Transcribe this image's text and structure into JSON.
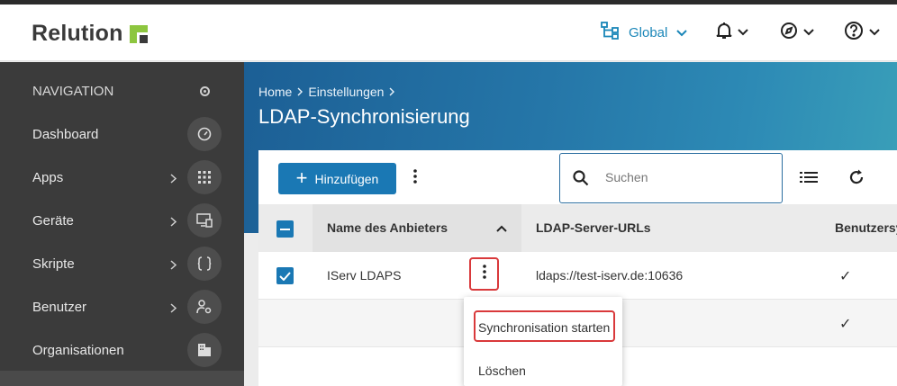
{
  "header": {
    "logo_text": "Relution",
    "global_label": "Global",
    "colors": {
      "accent": "#1a86b8",
      "logo_green": "#8dc63f",
      "logo_text": "#3a3a3a"
    },
    "icons": [
      "org-tree-icon",
      "chevron-down-icon",
      "bell-icon",
      "compass-icon",
      "help-icon"
    ]
  },
  "sidebar": {
    "heading": "NAVIGATION",
    "items": [
      {
        "label": "Dashboard",
        "icon": "speedometer-icon",
        "has_arrow": false
      },
      {
        "label": "Apps",
        "icon": "grid-icon",
        "has_arrow": true
      },
      {
        "label": "Geräte",
        "icon": "devices-icon",
        "has_arrow": true
      },
      {
        "label": "Skripte",
        "icon": "braces-icon",
        "has_arrow": true
      },
      {
        "label": "Benutzer",
        "icon": "user-settings-icon",
        "has_arrow": true
      },
      {
        "label": "Organisationen",
        "icon": "building-icon",
        "has_arrow": false
      }
    ]
  },
  "page": {
    "breadcrumb": [
      "Home",
      "Einstellungen"
    ],
    "title": "LDAP-Synchronisierung"
  },
  "toolbar": {
    "add_label": "Hinzufügen",
    "search_placeholder": "Suchen"
  },
  "table": {
    "columns": [
      "Name des Anbieters",
      "LDAP-Server-URLs",
      "Benutzersy"
    ],
    "rows": [
      {
        "name": "IServ LDAPS",
        "url": "ldaps://test-iserv.de:10636",
        "checked": true,
        "user_sync": "✓"
      },
      {
        "name": "",
        "url": "",
        "checked": false,
        "user_sync": "✓"
      }
    ]
  },
  "context_menu": {
    "items": [
      "Synchronisation starten",
      "Löschen"
    ]
  }
}
